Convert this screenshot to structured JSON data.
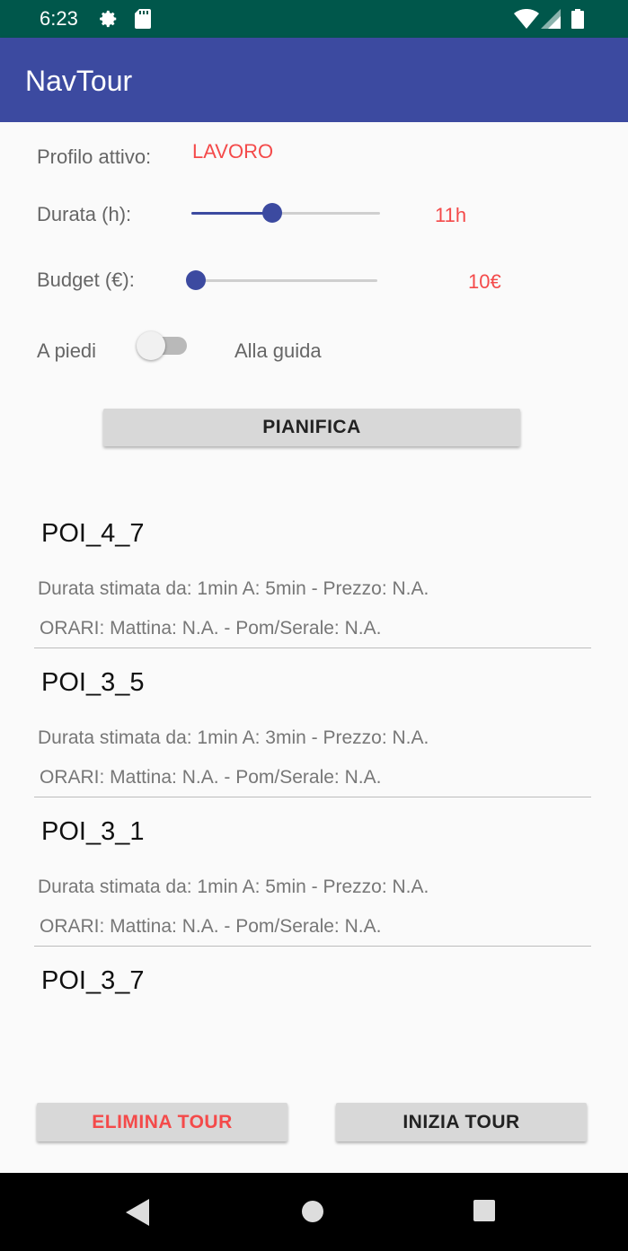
{
  "status_bar": {
    "time": "6:23",
    "icons": [
      "settings-icon",
      "sd-card-icon",
      "wifi-icon",
      "signal-icon",
      "battery-icon"
    ]
  },
  "app_bar": {
    "title": "NavTour",
    "color": "#3c4aa0"
  },
  "profile": {
    "label": "Profilo attivo:",
    "value": "LAVORO"
  },
  "duration": {
    "label": "Durata (h):",
    "value_text": "11h",
    "slider_fraction": 0.43
  },
  "budget": {
    "label": "Budget (€):",
    "value_text": "10€",
    "slider_fraction": 0.0
  },
  "mode": {
    "left_label": "A piedi",
    "right_label": "Alla guida",
    "switch_on": false
  },
  "plan_button": "PIANIFICA",
  "pois": [
    {
      "title": "POI_4_7",
      "line1": "Durata stimata da: 1min A: 5min - Prezzo: N.A.",
      "line2": "ORARI: Mattina: N.A. - Pom/Serale: N.A."
    },
    {
      "title": "POI_3_5",
      "line1": "Durata stimata da: 1min A: 3min - Prezzo: N.A.",
      "line2": "ORARI: Mattina: N.A. - Pom/Serale: N.A."
    },
    {
      "title": "POI_3_1",
      "line1": "Durata stimata da: 1min A: 5min - Prezzo: N.A.",
      "line2": "ORARI: Mattina: N.A. - Pom/Serale: N.A."
    },
    {
      "title": "POI_3_7"
    }
  ],
  "actions": {
    "delete": "ELIMINA TOUR",
    "start": "INIZIA TOUR"
  },
  "colors": {
    "accent": "#f44a4a",
    "primary": "#3c4aa0",
    "status_bar": "#00574b"
  },
  "nav_bar": {
    "icons": [
      "back-icon",
      "home-icon",
      "recents-icon"
    ]
  }
}
